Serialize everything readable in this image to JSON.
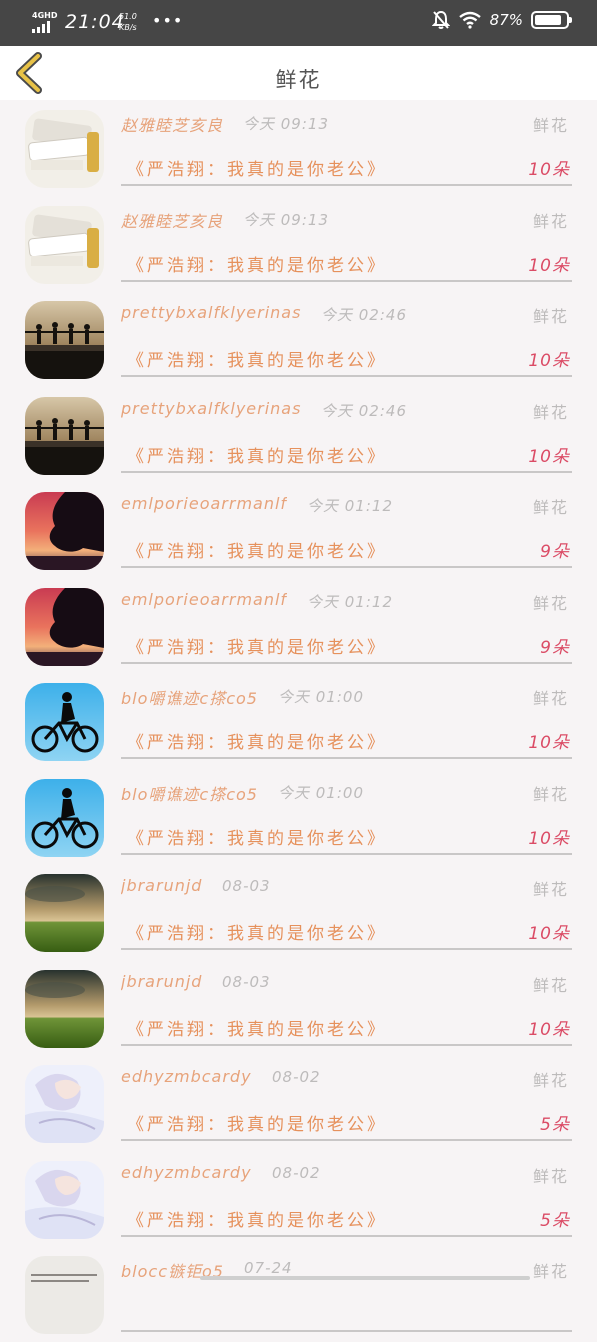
{
  "status_bar": {
    "network": "4GHD",
    "time": "21:04",
    "speed_value": "51.0",
    "speed_unit": "KB/s",
    "more": "•••",
    "battery": "87%",
    "battery_level": 0.87
  },
  "nav": {
    "title": "鲜花",
    "back_icon": "chevron-left-icon",
    "accent": "#e8c247"
  },
  "list": [
    {
      "name": "赵雅睦芝亥良",
      "time": "今天 09:13",
      "type": "鲜花",
      "message": "《严浩翔：我真的是你老公》",
      "count": "10朵",
      "avatar": "doc"
    },
    {
      "name": "赵雅睦芝亥良",
      "time": "今天 09:13",
      "type": "鲜花",
      "message": "《严浩翔：我真的是你老公》",
      "count": "10朵",
      "avatar": "doc"
    },
    {
      "name": "prettybxalfklyerinasp",
      "time": "今天 02:46",
      "type": "鲜花",
      "message": "《严浩翔：我真的是你老公》",
      "count": "10朵",
      "avatar": "kids"
    },
    {
      "name": "prettybxalfklyerinasp",
      "time": "今天 02:46",
      "type": "鲜花",
      "message": "《严浩翔：我真的是你老公》",
      "count": "10朵",
      "avatar": "kids"
    },
    {
      "name": "emlporieoarrmanlf",
      "time": "今天 01:12",
      "type": "鲜花",
      "message": "《严浩翔：我真的是你老公》",
      "count": "9朵",
      "avatar": "sunset"
    },
    {
      "name": "emlporieoarrmanlf",
      "time": "今天 01:12",
      "type": "鲜花",
      "message": "《严浩翔：我真的是你老公》",
      "count": "9朵",
      "avatar": "sunset"
    },
    {
      "name": "blo嚼谯迹c搽co5",
      "time": "今天 01:00",
      "type": "鲜花",
      "message": "《严浩翔：我真的是你老公》",
      "count": "10朵",
      "avatar": "bike"
    },
    {
      "name": "blo嚼谯迹c搽co5",
      "time": "今天 01:00",
      "type": "鲜花",
      "message": "《严浩翔：我真的是你老公》",
      "count": "10朵",
      "avatar": "bike"
    },
    {
      "name": "jbrarunjd",
      "time": "08-03",
      "type": "鲜花",
      "message": "《严浩翔：我真的是你老公》",
      "count": "10朵",
      "avatar": "field"
    },
    {
      "name": "jbrarunjd",
      "time": "08-03",
      "type": "鲜花",
      "message": "《严浩翔：我真的是你老公》",
      "count": "10朵",
      "avatar": "field"
    },
    {
      "name": "edhyzmbcardy",
      "time": "08-02",
      "type": "鲜花",
      "message": "《严浩翔：我真的是你老公》",
      "count": "5朵",
      "avatar": "anime"
    },
    {
      "name": "edhyzmbcardy",
      "time": "08-02",
      "type": "鲜花",
      "message": "《严浩翔：我真的是你老公》",
      "count": "5朵",
      "avatar": "anime"
    },
    {
      "name": "blocc镞钜o5",
      "time": "07-24",
      "type": "鲜花",
      "message": "",
      "count": "",
      "avatar": "text"
    }
  ]
}
